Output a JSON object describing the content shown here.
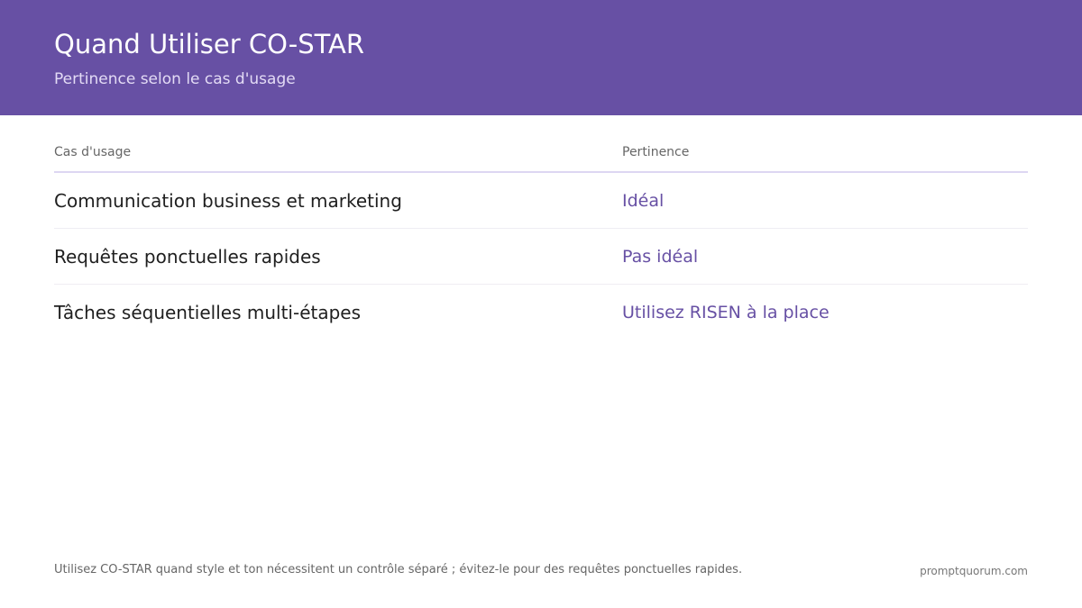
{
  "header": {
    "title": "Quand Utiliser CO-STAR",
    "subtitle": "Pertinence selon le cas d'usage",
    "background_color": "#6750a4"
  },
  "table": {
    "columns": [
      "Cas d'usage",
      "Pertinence"
    ],
    "rows": [
      {
        "use_case": "Communication business et marketing",
        "fit": "Idéal"
      },
      {
        "use_case": "Requêtes ponctuelles rapides",
        "fit": "Pas idéal"
      },
      {
        "use_case": "Tâches séquentielles multi-étapes",
        "fit": "Utilisez RISEN à la place"
      }
    ],
    "accent_color": "#6750a4"
  },
  "footer": {
    "note": "Utilisez CO-STAR quand style et ton nécessitent un contrôle séparé ; évitez-le pour des requêtes ponctuelles rapides.",
    "brand": "promptquorum.com"
  }
}
